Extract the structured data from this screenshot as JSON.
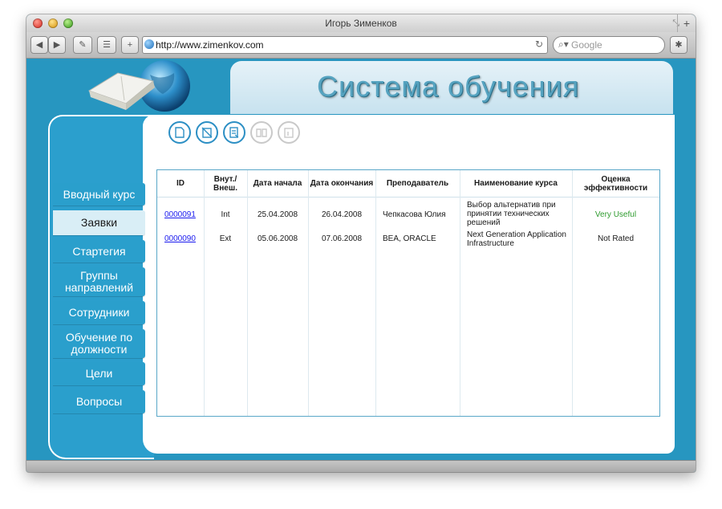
{
  "window": {
    "title": "Игорь Зименков"
  },
  "toolbar": {
    "url": "http://www.zimenkov.com",
    "search_placeholder": "Google"
  },
  "banner": {
    "title": "Система обучения"
  },
  "nav": {
    "items": [
      {
        "label": "Вводный курс"
      },
      {
        "label": "Заявки"
      },
      {
        "label": "Стартегия"
      },
      {
        "label": "Группы направлений"
      },
      {
        "label": "Сотрудники"
      },
      {
        "label": "Обучение по должности"
      },
      {
        "label": "Цели"
      },
      {
        "label": "Вопросы"
      }
    ],
    "active_index": 1
  },
  "table": {
    "columns": [
      "ID",
      "Внут./ Внеш.",
      "Дата начала",
      "Дата окончания",
      "Преподаватель",
      "Наименование курса",
      "Оценка эффективности"
    ],
    "rows": [
      {
        "id": "0000091",
        "type": "Int",
        "start": "25.04.2008",
        "end": "26.04.2008",
        "teacher": "Чепкасова Юлия",
        "course": "Выбор альтернатив при принятии технических решений",
        "rating": "Very Useful"
      },
      {
        "id": "0000090",
        "type": "Ext",
        "start": "05.06.2008",
        "end": "07.06.2008",
        "teacher": "BEA, ORACLE",
        "course": "Next Generation Application Infrastructure",
        "rating": "Not Rated"
      }
    ]
  },
  "colors": {
    "brand_blue": "#2796c0",
    "accent_green": "#2e9b2e",
    "link_blue": "#1a1aee"
  }
}
